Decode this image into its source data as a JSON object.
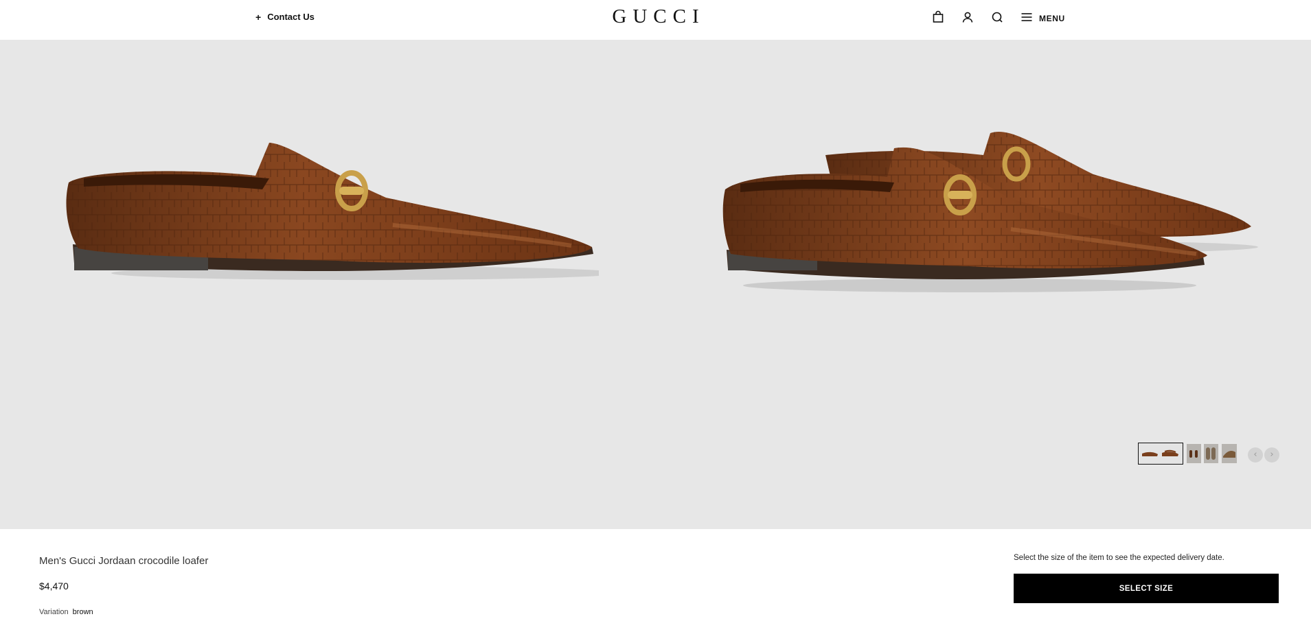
{
  "header": {
    "contact_icon": "plus-icon",
    "contact_label": "Contact Us",
    "logo": "GUCCI",
    "icons": [
      "shopping-bag-icon",
      "user-icon",
      "search-icon",
      "hamburger-menu-icon"
    ],
    "menu_label": "MENU"
  },
  "gallery": {
    "background": "#e7e7e7",
    "images": [
      "loafer-side-view",
      "loafer-pair-view"
    ],
    "thumbnails": [
      {
        "name": "thumbnail-side-and-pair",
        "active": true
      },
      {
        "name": "thumbnail-top-view",
        "active": false
      },
      {
        "name": "thumbnail-soles-view",
        "active": false
      },
      {
        "name": "thumbnail-detail-view",
        "active": false
      }
    ],
    "prev_icon": "‹",
    "next_icon": "›"
  },
  "product": {
    "name": "Men's Gucci Jordaan crocodile loafer",
    "price": "$4,470",
    "variation_label": "Variation",
    "variation_value": "brown"
  },
  "purchase": {
    "size_note": "Select the size of the item to see the expected delivery date.",
    "select_size_label": "SELECT SIZE"
  },
  "colors": {
    "accent": "#000000",
    "leather": "#7a3f1c",
    "hardware_gold": "#c9a04a"
  }
}
